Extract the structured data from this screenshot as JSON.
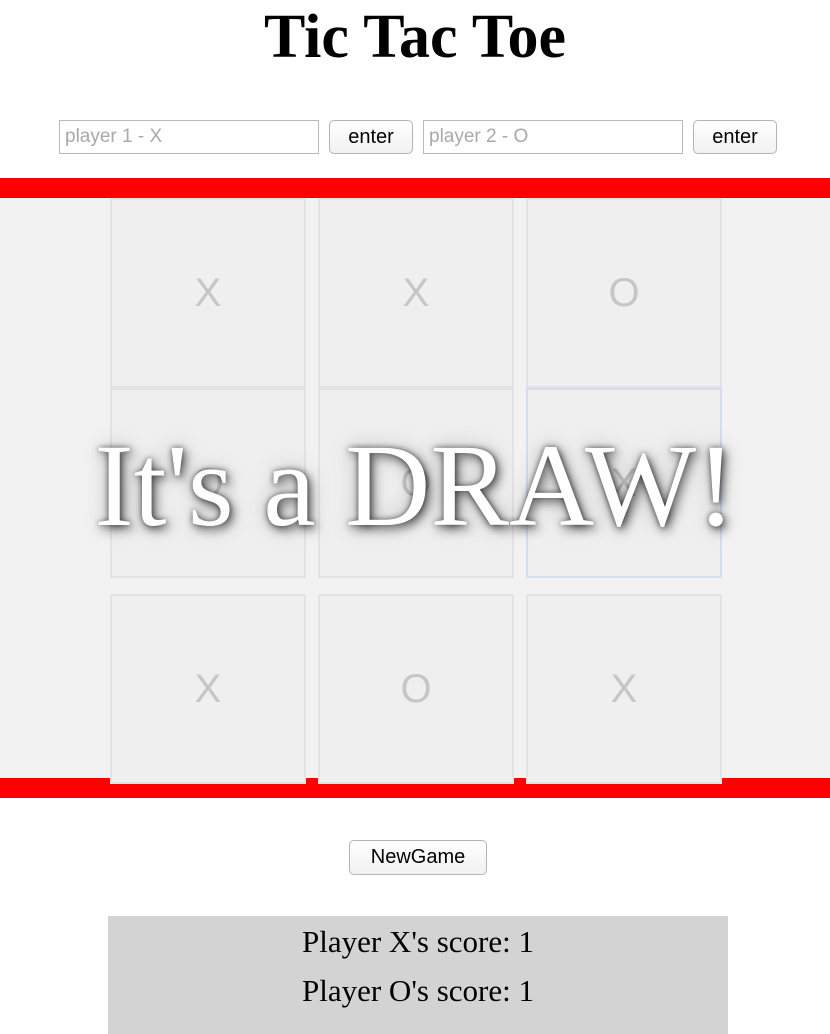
{
  "title": "Tic Tac Toe",
  "inputs": {
    "player1_placeholder": "player 1 - X",
    "player1_value": "",
    "player2_placeholder": "player 2 - O",
    "player2_value": "",
    "enter1_label": "enter",
    "enter2_label": "enter"
  },
  "board": {
    "cells": [
      "X",
      "X",
      "O",
      "O",
      "O",
      "X",
      "X",
      "O",
      "X"
    ],
    "border_color": "#ff0000",
    "background_color": "#f2f2f2"
  },
  "message": "It's a DRAW!",
  "new_game_label": "NewGame",
  "scores": {
    "x_text": "Player X's score: 1",
    "o_text": "Player O's score: 1"
  }
}
